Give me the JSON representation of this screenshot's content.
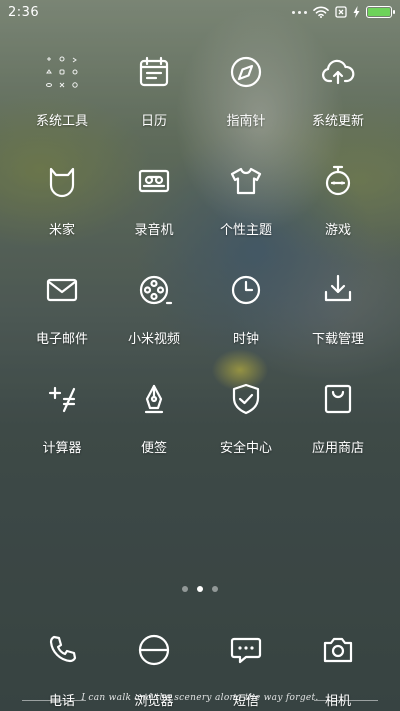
{
  "status_bar": {
    "time": "2:36",
    "icons": [
      "signal-dots-icon",
      "wifi-icon",
      "sim-off-icon",
      "charging-icon",
      "battery-icon"
    ],
    "battery_color": "#6ed35a"
  },
  "apps": [
    {
      "label": "系统工具",
      "icon": "folder-tools-icon"
    },
    {
      "label": "日历",
      "icon": "calendar-icon"
    },
    {
      "label": "指南针",
      "icon": "compass-icon"
    },
    {
      "label": "系统更新",
      "icon": "cloud-upload-icon"
    },
    {
      "label": "米家",
      "icon": "mijia-icon"
    },
    {
      "label": "录音机",
      "icon": "cassette-icon"
    },
    {
      "label": "个性主题",
      "icon": "tshirt-icon"
    },
    {
      "label": "游戏",
      "icon": "game-icon"
    },
    {
      "label": "电子邮件",
      "icon": "mail-icon"
    },
    {
      "label": "小米视频",
      "icon": "film-reel-icon"
    },
    {
      "label": "时钟",
      "icon": "clock-icon"
    },
    {
      "label": "下载管理",
      "icon": "download-icon"
    },
    {
      "label": "计算器",
      "icon": "calculator-icon"
    },
    {
      "label": "便签",
      "icon": "pen-nib-icon"
    },
    {
      "label": "安全中心",
      "icon": "shield-check-icon"
    },
    {
      "label": "应用商店",
      "icon": "shopping-bag-icon"
    }
  ],
  "pager": {
    "pages": 3,
    "active": 2
  },
  "dock": [
    {
      "label": "电话",
      "icon": "phone-icon"
    },
    {
      "label": "浏览器",
      "icon": "browser-icon"
    },
    {
      "label": "短信",
      "icon": "message-icon"
    },
    {
      "label": "相机",
      "icon": "camera-icon"
    }
  ],
  "wallpaper": {
    "caption": "I can walk and the scenery along the way forget."
  }
}
